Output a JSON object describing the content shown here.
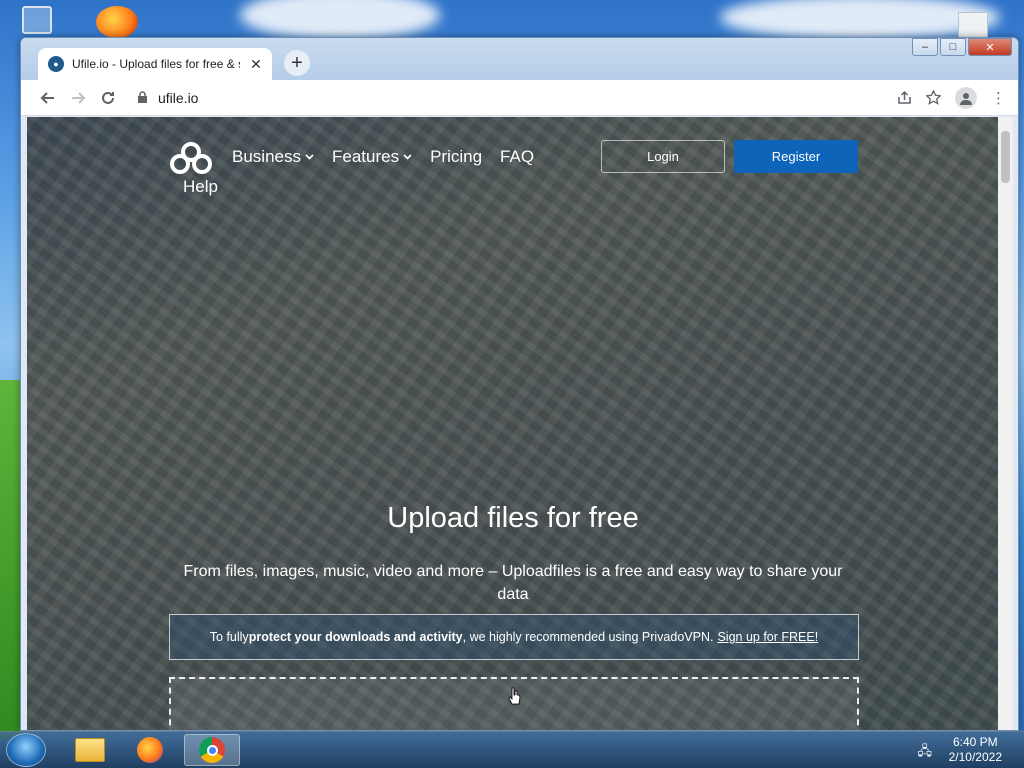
{
  "browser": {
    "tab_title": "Ufile.io - Upload files for free & s",
    "new_tab_label": "+",
    "url": "ufile.io",
    "window_controls": {
      "minimize": "–",
      "maximize": "□",
      "close": "✕"
    }
  },
  "site": {
    "nav": {
      "business": "Business",
      "features": "Features",
      "pricing": "Pricing",
      "faq": "FAQ",
      "help": "Help"
    },
    "login_label": "Login",
    "register_label": "Register",
    "hero_title": "Upload files for free",
    "hero_subtitle": "From files, images, music, video and more – Uploadfiles is a free and easy way to share your data",
    "promo": {
      "prefix": "To fully ",
      "bold": "protect your downloads and activity",
      "suffix": ", we highly recommended using PrivadoVPN.",
      "link": "Sign up for FREE!"
    }
  },
  "taskbar": {
    "clock_time": "6:40 PM",
    "clock_date": "2/10/2022"
  },
  "colors": {
    "register_bg": "#0d64b8",
    "titlebar": "#c9dbef"
  }
}
